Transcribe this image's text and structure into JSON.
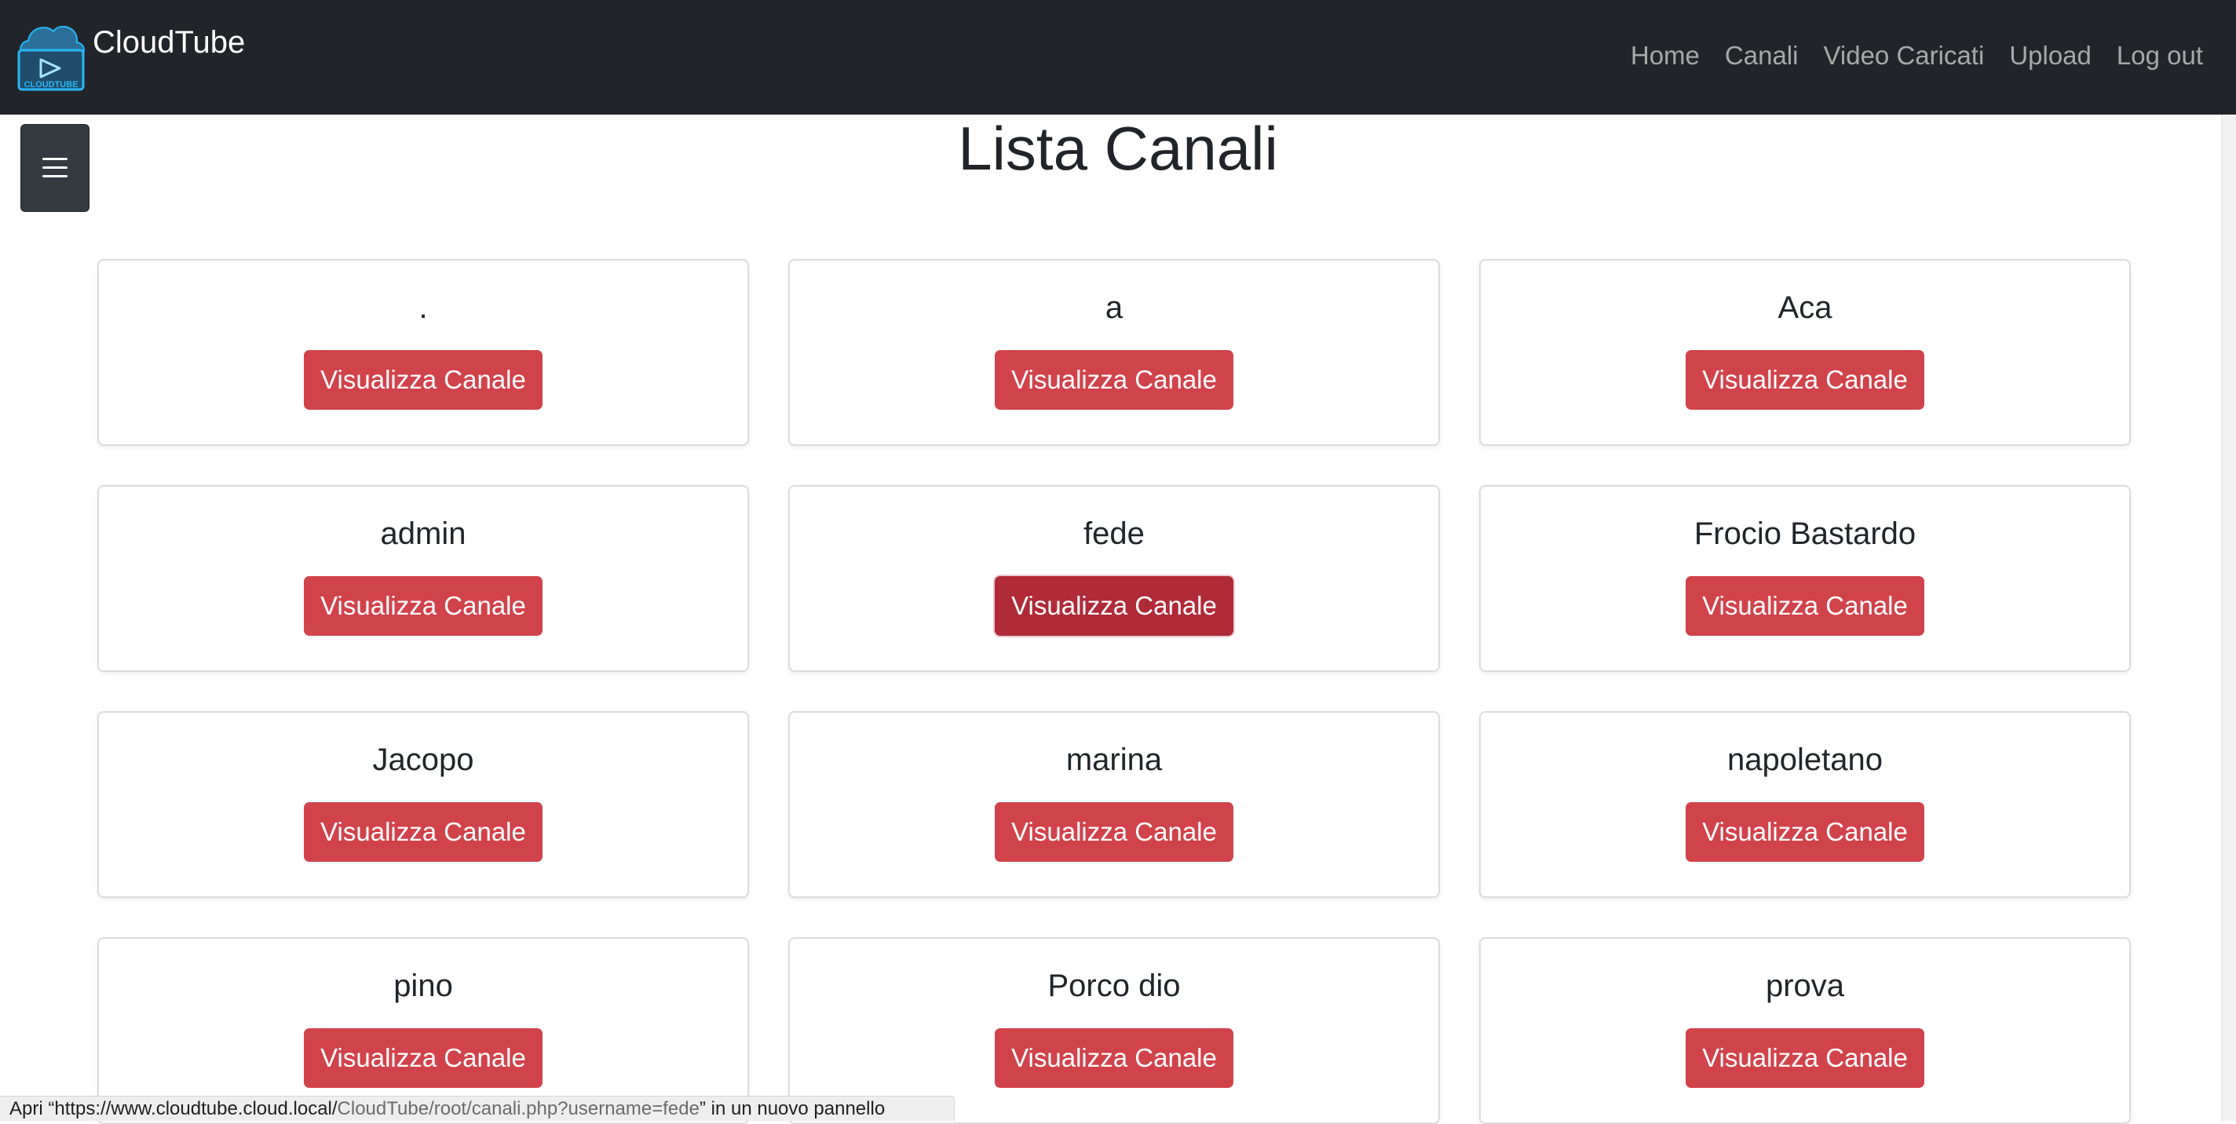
{
  "navbar": {
    "brand_name": "CloudTube",
    "logo_text": "CLOUDTUBE",
    "links": [
      {
        "label": "Home"
      },
      {
        "label": "Canali"
      },
      {
        "label": "Video Caricati"
      },
      {
        "label": "Upload"
      },
      {
        "label": "Log out"
      }
    ]
  },
  "page": {
    "title": "Lista Canali"
  },
  "channels": [
    {
      "name": ".",
      "button_label": "Visualizza Canale"
    },
    {
      "name": "a",
      "button_label": "Visualizza Canale"
    },
    {
      "name": "Aca",
      "button_label": "Visualizza Canale"
    },
    {
      "name": "admin",
      "button_label": "Visualizza Canale"
    },
    {
      "name": "fede",
      "button_label": "Visualizza Canale",
      "hovered": true
    },
    {
      "name": "Frocio Bastardo",
      "button_label": "Visualizza Canale"
    },
    {
      "name": "Jacopo",
      "button_label": "Visualizza Canale"
    },
    {
      "name": "marina",
      "button_label": "Visualizza Canale"
    },
    {
      "name": "napoletano",
      "button_label": "Visualizza Canale"
    },
    {
      "name": "pino",
      "button_label": "Visualizza Canale"
    },
    {
      "name": "Porco dio",
      "button_label": "Visualizza Canale"
    },
    {
      "name": "prova",
      "button_label": "Visualizza Canale"
    }
  ],
  "status_bar": {
    "prefix": "Apri “",
    "url_host": "https://www.cloudtube.cloud.local/",
    "url_path": "CloudTube/root/canali.php?username=fede",
    "suffix": "” in un nuovo pannello"
  },
  "colors": {
    "navbar_bg": "#212529",
    "button_red": "#d1434b",
    "button_red_hover": "#b02a37",
    "logo_blue": "#29b6f6"
  },
  "icons": {
    "logo": "cloud-play-icon",
    "sidebar_toggle": "hamburger-menu-icon"
  }
}
